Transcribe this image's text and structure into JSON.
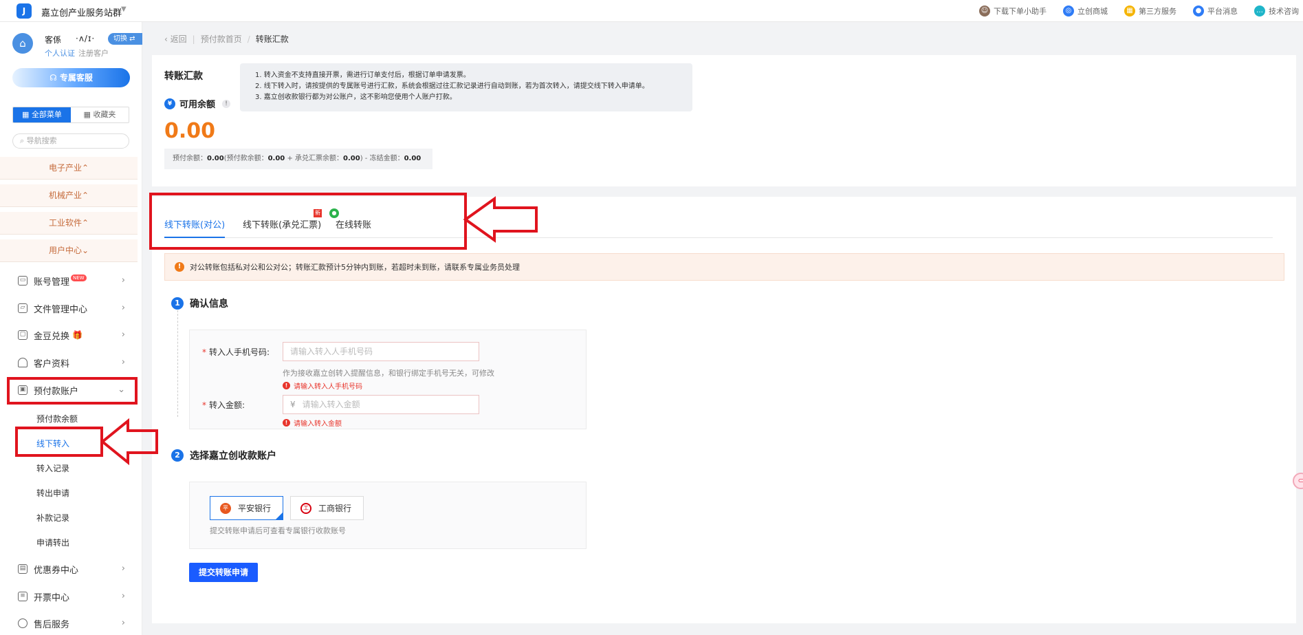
{
  "topbar": {
    "site_name": "嘉立创产业服务站群",
    "links": [
      {
        "label": "下载下单小助手",
        "icon": "helper-icon",
        "color": "#8a6d5a"
      },
      {
        "label": "立创商城",
        "icon": "mall-icon",
        "color": "#2f7cf6"
      },
      {
        "label": "第三方服务",
        "icon": "grid-icon",
        "color": "#f5b400"
      },
      {
        "label": "平台消息",
        "icon": "bell-icon",
        "color": "#2f7cf6"
      },
      {
        "label": "技术咨询",
        "icon": "chat-icon",
        "color": "#1fb5c9"
      }
    ]
  },
  "sidebar": {
    "user_name": "客係",
    "user_mask": "·ʌ/ɪ·",
    "switch_label": "切换",
    "tags": [
      "个人认证",
      "注册客户"
    ],
    "cs_button": "专属客服",
    "menu_tabs": [
      "全部菜单",
      "收藏夹"
    ],
    "search_placeholder": "导航搜索",
    "industries": [
      "电子产业",
      "机械产业",
      "工业软件",
      "用户中心"
    ],
    "items": [
      {
        "label": "账号管理",
        "badge": "NEW"
      },
      {
        "label": "文件管理中心"
      },
      {
        "label": "金豆兑换"
      },
      {
        "label": "客户资料"
      },
      {
        "label": "预付款账户"
      },
      {
        "label": "优惠券中心"
      },
      {
        "label": "开票中心"
      },
      {
        "label": "售后服务"
      }
    ],
    "sub_items": [
      "预付款余额",
      "线下转入",
      "转入记录",
      "转出申请",
      "补款记录",
      "申请转出"
    ]
  },
  "breadcrumb": {
    "back": "返回",
    "parent": "预付款首页",
    "current": "转账汇款"
  },
  "summary": {
    "title": "转账汇款",
    "notices": [
      "1. 转入资金不支持直接开票，需进行订单支付后，根据订单申请发票。",
      "2. 线下转入时，请按提供的专属账号进行汇款，系统会根据过往汇款记录进行自动到账，若为首次转入，请提交线下转入申请单。",
      "3. 嘉立创收款银行都为对公账户，这不影响您使用个人账户打款。"
    ],
    "balance_label": "可用余额",
    "balance": "0.00",
    "detail": {
      "prepay_label": "预付余额：",
      "prepay": "0.00",
      "advance_label": "(预付款余额：",
      "advance": "0.00",
      "acceptance_label": " + 承兑汇票余额：",
      "acceptance": "0.00",
      "frozen_label": ") - 冻结金额：",
      "frozen": "0.00"
    }
  },
  "tabs": [
    "线下转账(对公)",
    "线下转账(承兑汇票)",
    "在线转账"
  ],
  "tab_new_tag": "新",
  "alert": "对公转账包括私对公和公对公；转账汇款预计5分钟内到账，若超时未到账，请联系专属业务员处理",
  "step1": {
    "num": "1",
    "title": "确认信息",
    "phone_label": "转入人手机号码:",
    "phone_placeholder": "请输入转入人手机号码",
    "phone_hint": "作为接收嘉立创转入提醒信息，和银行绑定手机号无关，可修改",
    "phone_error": "请输入转入人手机号码",
    "amount_label": "转入金额:",
    "currency": "¥",
    "amount_placeholder": "请输入转入金额",
    "amount_error": "请输入转入金额"
  },
  "step2": {
    "num": "2",
    "title": "选择嘉立创收款账户",
    "banks": [
      {
        "label": "平安银行",
        "icon": "pingan-bank-icon",
        "color": "#e8581f"
      },
      {
        "label": "工商银行",
        "icon": "icbc-bank-icon",
        "color": "#d7000f"
      }
    ],
    "hint": "提交转账申请后可查看专属银行收款账号"
  },
  "submit_label": "提交转账申请",
  "float_label": "⊂"
}
